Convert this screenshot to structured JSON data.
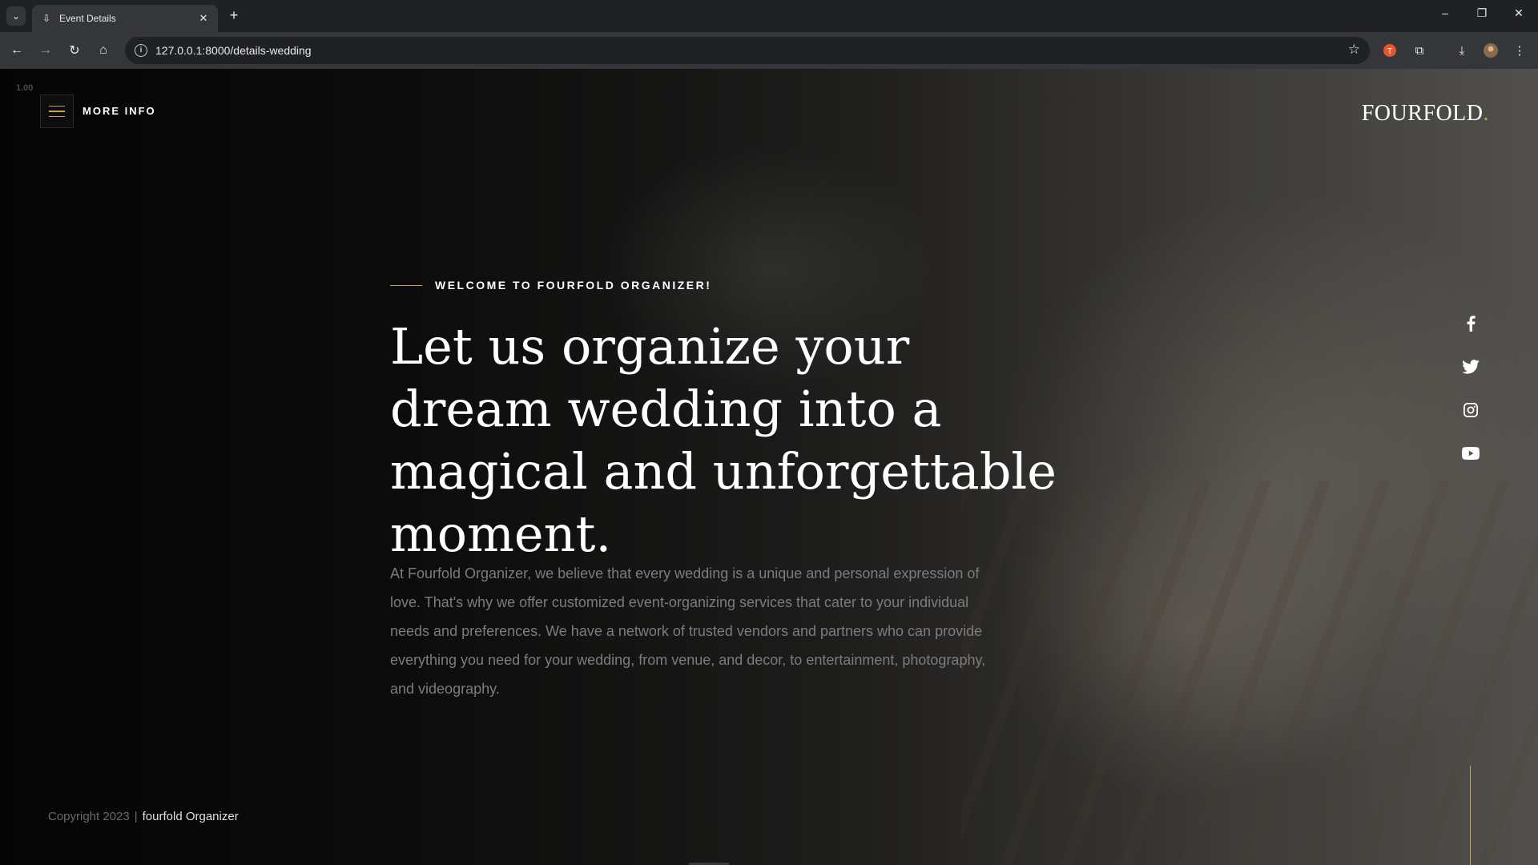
{
  "browser": {
    "tab_title": "Event Details",
    "url": "127.0.0.1:8000/details-wedding"
  },
  "page": {
    "zoom_indicator": "1.00",
    "menu_label": "MORE INFO",
    "logo_text": "FOURFOLD",
    "logo_dot": ".",
    "tagline": "WELCOME TO FOURFOLD ORGANIZER!",
    "headline": "Let us organize your dream wedding into a magical and unforgettable moment.",
    "body": "At Fourfold Organizer, we believe that every wedding is a unique and personal expression of love. That's why we offer customized event-organizing services that cater to your individual needs and preferences. We have a network of trusted vendors and partners who can provide everything you need for your wedding, from venue, and decor, to entertainment, photography, and videography.",
    "copyright": "Copyright 2023",
    "copyright_sep": "|",
    "copyright_brand": "fourfold Organizer",
    "social": [
      "facebook-icon",
      "twitter-icon",
      "instagram-icon",
      "youtube-icon"
    ]
  },
  "colors": {
    "accent": "#c8a25c",
    "text_white": "#ffffff",
    "body_gray": "#7c7c7c"
  }
}
